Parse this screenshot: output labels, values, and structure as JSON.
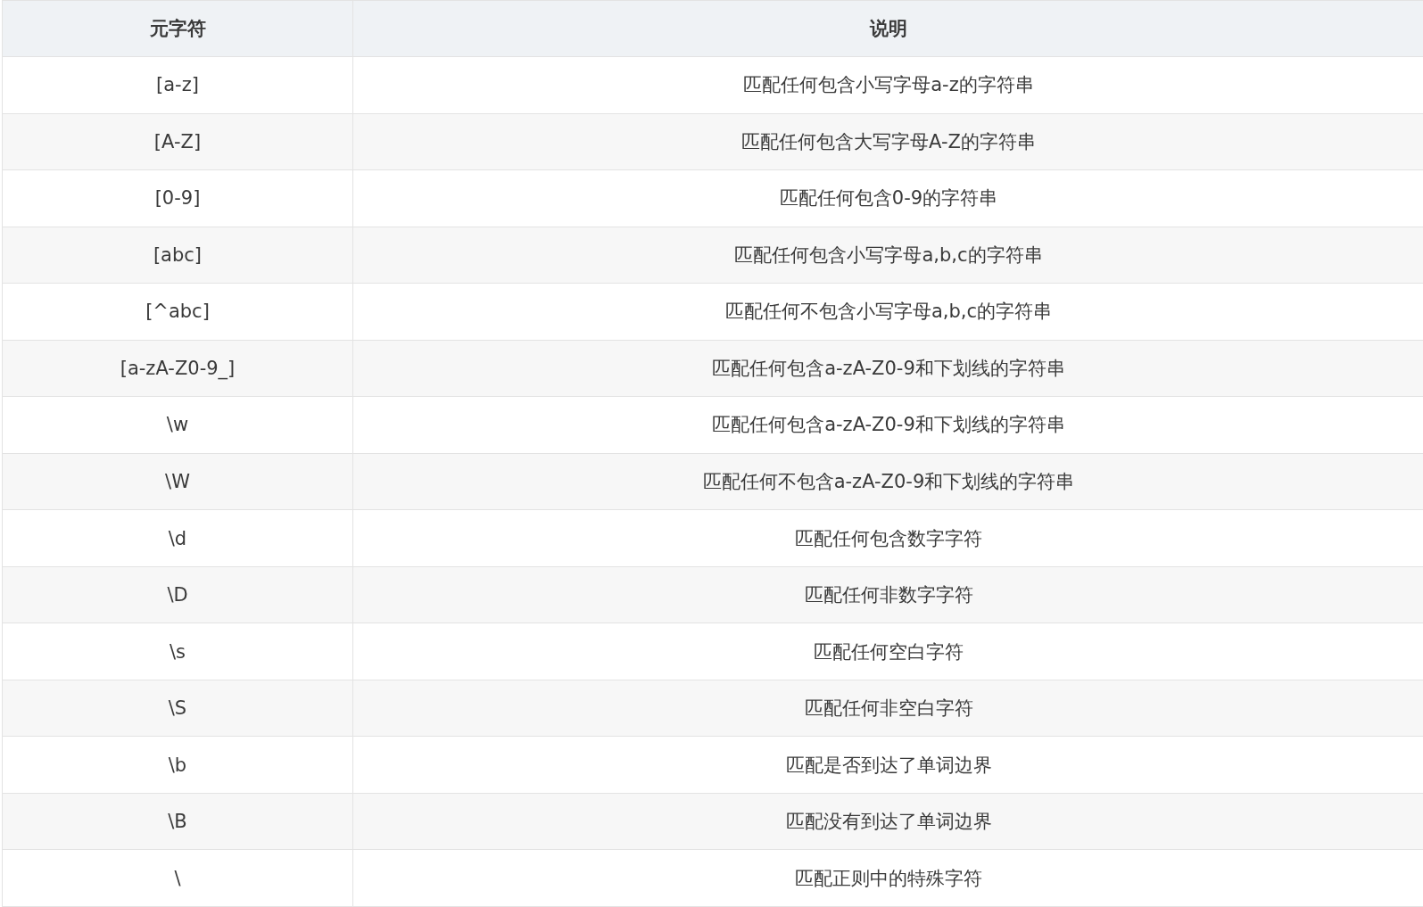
{
  "table": {
    "columns": [
      "元字符",
      "说明"
    ],
    "rows": [
      [
        "[a-z]",
        "匹配任何包含小写字母a-z的字符串"
      ],
      [
        "[A-Z]",
        "匹配任何包含大写字母A-Z的字符串"
      ],
      [
        "[0-9]",
        "匹配任何包含0-9的字符串"
      ],
      [
        "[abc]",
        "匹配任何包含小写字母a,b,c的字符串"
      ],
      [
        "[^abc]",
        "匹配任何不包含小写字母a,b,c的字符串"
      ],
      [
        "[a-zA-Z0-9_]",
        "匹配任何包含a-zA-Z0-9和下划线的字符串"
      ],
      [
        "\\w",
        "匹配任何包含a-zA-Z0-9和下划线的字符串"
      ],
      [
        "\\W",
        "匹配任何不包含a-zA-Z0-9和下划线的字符串"
      ],
      [
        "\\d",
        "匹配任何包含数字字符"
      ],
      [
        "\\D",
        "匹配任何非数字字符"
      ],
      [
        "\\s",
        "匹配任何空白字符"
      ],
      [
        "\\S",
        "匹配任何非空白字符"
      ],
      [
        "\\b",
        "匹配是否到达了单词边界"
      ],
      [
        "\\B",
        "匹配没有到达了单词边界"
      ],
      [
        "\\",
        "匹配正则中的特殊字符"
      ]
    ]
  }
}
